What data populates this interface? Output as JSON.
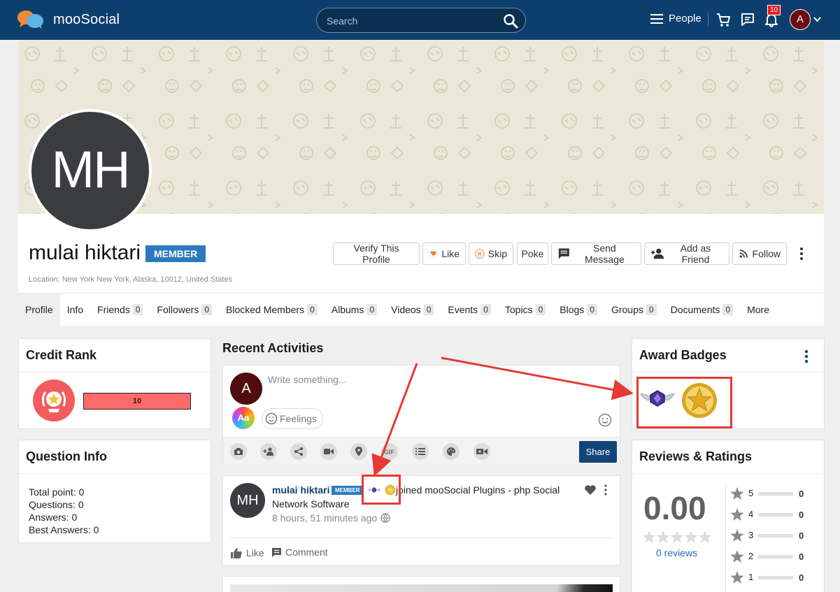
{
  "header": {
    "brand": "mooSocial",
    "search_placeholder": "Search",
    "people_label": "People",
    "notifications_count": "10",
    "user_initial": "A"
  },
  "profile": {
    "initials": "MH",
    "name": "mulai hiktari",
    "role_tag": "MEMBER",
    "location": "Location: New York New York, Alaska, 10012, United States",
    "actions": {
      "verify": "Verify This Profile",
      "like": "Like",
      "skip": "Skip",
      "poke": "Poke",
      "send_message": "Send Message",
      "add_friend": "Add as Friend",
      "follow": "Follow"
    }
  },
  "tabs": [
    {
      "label": "Profile",
      "count": null
    },
    {
      "label": "Info",
      "count": null
    },
    {
      "label": "Friends",
      "count": "0"
    },
    {
      "label": "Followers",
      "count": "0"
    },
    {
      "label": "Blocked Members",
      "count": "0"
    },
    {
      "label": "Albums",
      "count": "0"
    },
    {
      "label": "Videos",
      "count": "0"
    },
    {
      "label": "Events",
      "count": "0"
    },
    {
      "label": "Topics",
      "count": "0"
    },
    {
      "label": "Blogs",
      "count": "0"
    },
    {
      "label": "Groups",
      "count": "0"
    },
    {
      "label": "Documents",
      "count": "0"
    },
    {
      "label": "More",
      "count": null
    }
  ],
  "credit_rank": {
    "title": "Credit Rank",
    "value": "10",
    "accent_color": "#ff6b6b"
  },
  "question_info": {
    "title": "Question Info",
    "lines": [
      "Total point: 0",
      "Questions: 0",
      "Answers: 0",
      "Best Answers: 0"
    ]
  },
  "feed": {
    "title": "Recent Activities",
    "composer": {
      "user_initial": "A",
      "placeholder": "Write something...",
      "font_button": "Aa",
      "feelings_label": "Feelings",
      "share_label": "Share",
      "tools": [
        "camera-icon",
        "tag-friend-icon",
        "share-icon",
        "video-icon",
        "location-icon",
        "gif-icon",
        "list-icon",
        "palette-icon",
        "live-video-icon"
      ]
    },
    "post": {
      "initials": "MH",
      "author": "mulai hiktari",
      "role_tag": "MEMBER",
      "text_line1": "joined mooSocial Plugins - php Social",
      "text_line2": "Network Software",
      "time": "8 hours, 51 minutes ago",
      "like_label": "Like",
      "comment_label": "Comment"
    }
  },
  "award_badges": {
    "title": "Award Badges",
    "badges": [
      "winged-gem-badge-icon",
      "gold-star-badge-icon"
    ]
  },
  "reviews": {
    "title": "Reviews & Ratings",
    "average": "0.00",
    "reviews_link": "0 reviews",
    "rows": [
      {
        "stars": "5",
        "count": "0"
      },
      {
        "stars": "4",
        "count": "0"
      },
      {
        "stars": "3",
        "count": "0"
      },
      {
        "stars": "2",
        "count": "0"
      },
      {
        "stars": "1",
        "count": "0"
      }
    ]
  },
  "colors": {
    "header_bg": "#0d3f6e",
    "brand_blue": "#2b7ac0",
    "annotation_red": "#e53935"
  }
}
